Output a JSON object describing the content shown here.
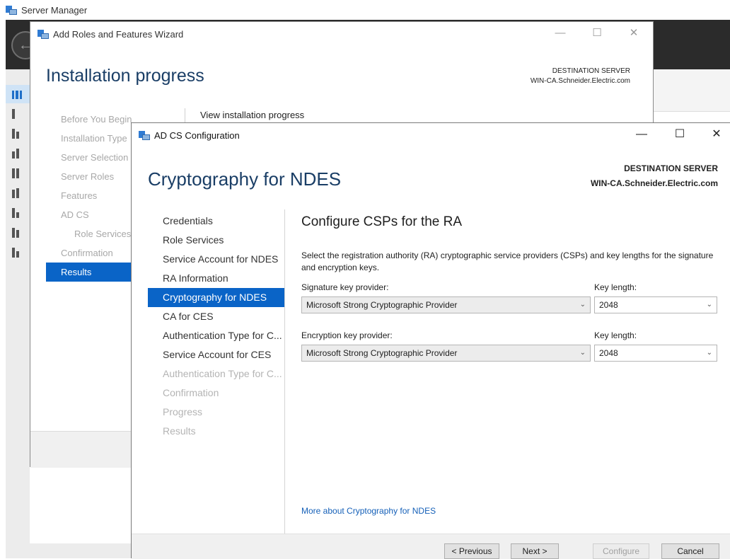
{
  "server_manager": {
    "title": "Server Manager"
  },
  "wizard": {
    "title": "Add Roles and Features Wizard",
    "heading": "Installation progress",
    "destination_label": "DESTINATION SERVER",
    "destination_server": "WIN-CA.Schneider.Electric.com",
    "nav": [
      {
        "label": "Before You Begin",
        "state": "disabled"
      },
      {
        "label": "Installation Type",
        "state": "disabled"
      },
      {
        "label": "Server Selection",
        "state": "disabled"
      },
      {
        "label": "Server Roles",
        "state": "disabled"
      },
      {
        "label": "Features",
        "state": "disabled"
      },
      {
        "label": "AD CS",
        "state": "disabled"
      },
      {
        "label": "Role Services",
        "state": "disabled-sub"
      },
      {
        "label": "Confirmation",
        "state": "disabled"
      },
      {
        "label": "Results",
        "state": "active"
      }
    ],
    "content_title": "View installation progress"
  },
  "dialog": {
    "title": "AD CS Configuration",
    "heading": "Cryptography for NDES",
    "destination_label": "DESTINATION SERVER",
    "destination_server": "WIN-CA.Schneider.Electric.com",
    "nav": [
      {
        "label": "Credentials",
        "state": "normal"
      },
      {
        "label": "Role Services",
        "state": "normal"
      },
      {
        "label": "Service Account for NDES",
        "state": "normal"
      },
      {
        "label": "RA Information",
        "state": "normal"
      },
      {
        "label": "Cryptography for NDES",
        "state": "active"
      },
      {
        "label": "CA for CES",
        "state": "normal"
      },
      {
        "label": "Authentication Type for C...",
        "state": "normal"
      },
      {
        "label": "Service Account for CES",
        "state": "normal"
      },
      {
        "label": "Authentication Type for C...",
        "state": "disabled"
      },
      {
        "label": "Confirmation",
        "state": "disabled"
      },
      {
        "label": "Progress",
        "state": "disabled"
      },
      {
        "label": "Results",
        "state": "disabled"
      }
    ],
    "section_title": "Configure CSPs for the RA",
    "description": "Select the registration authority (RA) cryptographic service providers (CSPs) and key lengths for the signature and encryption keys.",
    "signature": {
      "provider_label": "Signature key provider:",
      "provider_value": "Microsoft Strong Cryptographic Provider",
      "key_length_label": "Key length:",
      "key_length_value": "2048"
    },
    "encryption": {
      "provider_label": "Encryption key provider:",
      "provider_value": "Microsoft Strong Cryptographic Provider",
      "key_length_label": "Key length:",
      "key_length_value": "2048"
    },
    "more_link": "More about Cryptography for NDES",
    "buttons": {
      "previous": "< Previous",
      "next": "Next >",
      "configure": "Configure",
      "cancel": "Cancel"
    }
  },
  "window_controls": {
    "minimize": "—",
    "maximize": "☐",
    "close": "✕"
  },
  "colors": {
    "accent": "#0a64c7",
    "heading": "#1a3e66",
    "link": "#1560b8"
  }
}
